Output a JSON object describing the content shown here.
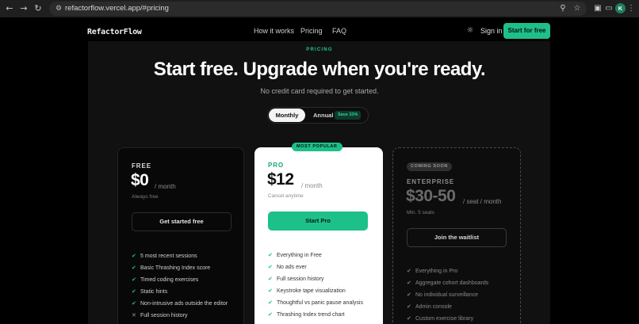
{
  "browser": {
    "url": "refactorflow.vercel.app/#pricing",
    "avatar_initial": "K"
  },
  "header": {
    "logo": "RefactorFlow",
    "nav": [
      "How it works",
      "Pricing",
      "FAQ"
    ],
    "sign_in": "Sign in",
    "cta": "Start for free"
  },
  "hero": {
    "eyebrow": "PRICING",
    "title": "Start free. Upgrade when you're ready.",
    "subtitle": "No credit card required to get started."
  },
  "billing_toggle": {
    "monthly": "Monthly",
    "annual": "Annual",
    "save": "Save 33%"
  },
  "plans": {
    "free": {
      "name": "FREE",
      "price": "$0",
      "period": "/ month",
      "note": "Always free",
      "cta": "Get started free",
      "features": [
        {
          "text": "5 most recent sessions",
          "included": true
        },
        {
          "text": "Basic Thrashing Index score",
          "included": true
        },
        {
          "text": "Timed coding exercises",
          "included": true
        },
        {
          "text": "Static hints",
          "included": true
        },
        {
          "text": "Non-intrusive ads outside the editor",
          "included": true
        },
        {
          "text": "Full session history",
          "included": false
        }
      ]
    },
    "pro": {
      "badge": "MOST POPULAR",
      "name": "PRO",
      "price": "$12",
      "period": "/ month",
      "note": "Cancel anytime",
      "cta": "Start Pro",
      "features": [
        {
          "text": "Everything in Free",
          "included": true
        },
        {
          "text": "No ads ever",
          "included": true
        },
        {
          "text": "Full session history",
          "included": true
        },
        {
          "text": "Keystroke tape visualization",
          "included": true
        },
        {
          "text": "Thoughtful vs panic pause analysis",
          "included": true
        },
        {
          "text": "Thrashing Index trend chart",
          "included": true
        }
      ]
    },
    "enterprise": {
      "badge": "COMING SOON",
      "name": "ENTERPRISE",
      "price": "$30-50",
      "period": "/ seat / month",
      "note": "Min. 5 seats",
      "cta": "Join the waitlist",
      "features": [
        {
          "text": "Everything in Pro",
          "included": true
        },
        {
          "text": "Aggregate cohort dashboards",
          "included": true
        },
        {
          "text": "No individual surveillance",
          "included": true
        },
        {
          "text": "Admin console",
          "included": true
        },
        {
          "text": "Custom exercise library",
          "included": true
        }
      ]
    }
  },
  "colors": {
    "accent": "#1ec08a",
    "background": "#000000",
    "panel": "#111111",
    "pro_card": "#ffffff"
  }
}
